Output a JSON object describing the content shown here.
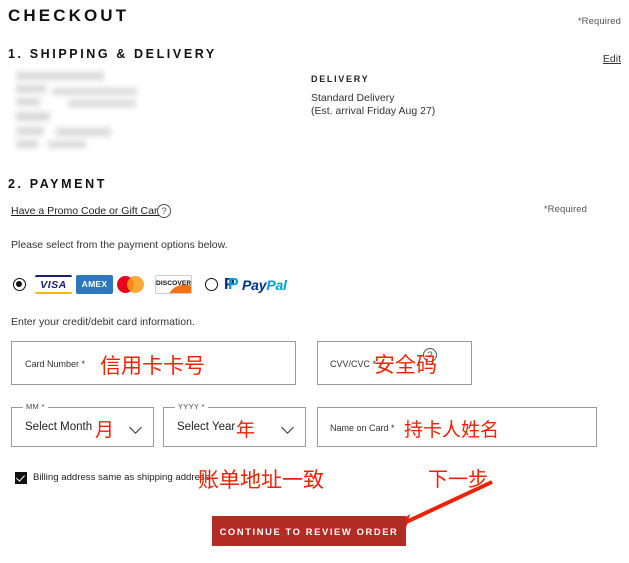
{
  "page": {
    "title": "CHECKOUT"
  },
  "shipping": {
    "heading": "1. SHIPPING & DELIVERY",
    "required_note": "*Required",
    "edit_label": "Edit",
    "address_redacted": true,
    "delivery": {
      "heading": "DELIVERY",
      "method": "Standard Delivery",
      "estimate": "(Est. arrival Friday Aug 27)"
    }
  },
  "payment": {
    "heading": "2. PAYMENT",
    "promo_link": "Have a Promo Code or Gift Card?",
    "promo_help_icon": "question-mark-icon",
    "required_note": "*Required",
    "options_instruction": "Please select from the payment options below.",
    "card_instruction": "Enter your credit/debit card information.",
    "methods": [
      {
        "id": "credit-card",
        "selected": true,
        "brands": [
          {
            "name": "VISA",
            "label": "VISA"
          },
          {
            "name": "AMEX",
            "label": "AMEX"
          },
          {
            "name": "Mastercard",
            "label": ""
          },
          {
            "name": "DISCOVER",
            "label": "DISCOVER"
          }
        ]
      },
      {
        "id": "paypal",
        "selected": false,
        "label_pay": "Pay",
        "label_pal": "Pal"
      }
    ],
    "fields": {
      "card_number": {
        "label": "Card Number *",
        "annotation": "信用卡卡号",
        "value": ""
      },
      "cvv": {
        "label": "CVV/CVC *",
        "annotation": "安全码",
        "help_icon": "question-mark-icon",
        "value": ""
      },
      "month": {
        "notch": "MM *",
        "value": "Select Month",
        "annotation": "月"
      },
      "year": {
        "notch": "YYYY *",
        "value": "Select Year",
        "annotation": "年"
      },
      "name_on_card": {
        "label": "Name on Card *",
        "annotation": "持卡人姓名",
        "value": ""
      }
    },
    "billing": {
      "checkbox_checked": true,
      "label": "Billing address same as shipping address",
      "annotation": "账单地址一致"
    },
    "submit": {
      "label": "CONTINUE TO REVIEW ORDER",
      "annotation": "下一步",
      "color": "#b42b23"
    }
  },
  "annotation_color": "#ee2200"
}
